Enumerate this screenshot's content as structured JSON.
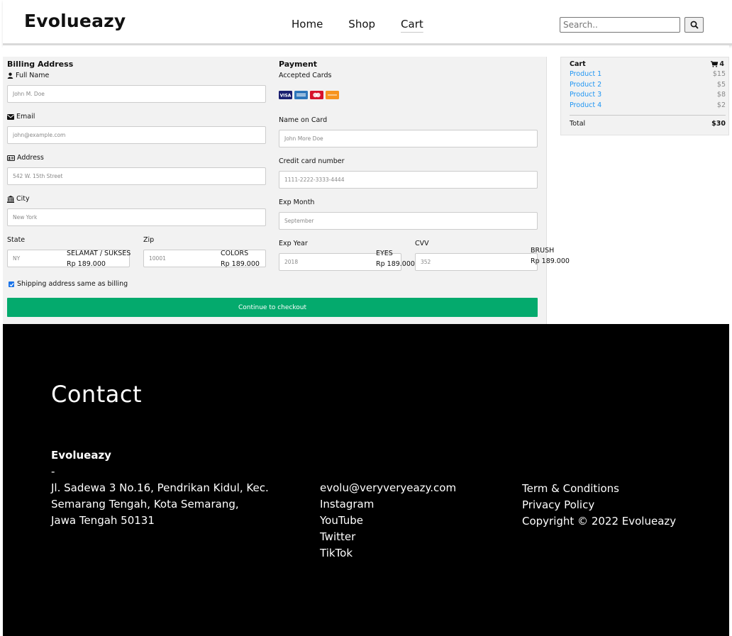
{
  "header": {
    "logo": "Evolueazy",
    "nav": [
      "Home",
      "Shop",
      "Cart"
    ],
    "search_placeholder": "Search.."
  },
  "billing": {
    "title": "Billing Address",
    "full_name_label": "Full Name",
    "full_name_placeholder": "John M. Doe",
    "email_label": "Email",
    "email_placeholder": "john@example.com",
    "address_label": "Address",
    "address_placeholder": "542 W. 15th Street",
    "city_label": "City",
    "city_placeholder": "New York",
    "state_label": "State",
    "state_placeholder": "NY",
    "zip_label": "Zip",
    "zip_placeholder": "10001"
  },
  "payment": {
    "title": "Payment",
    "accepted_cards_label": "Accepted Cards",
    "name_on_card_label": "Name on Card",
    "name_on_card_placeholder": "John More Doe",
    "cc_number_label": "Credit card number",
    "cc_number_placeholder": "1111-2222-3333-4444",
    "exp_month_label": "Exp Month",
    "exp_month_placeholder": "September",
    "exp_year_label": "Exp Year",
    "exp_year_placeholder": "2018",
    "cvv_label": "CVV",
    "cvv_placeholder": "352"
  },
  "shipping_same_label": "Shipping address same as billing",
  "checkout_button": "Continue to checkout",
  "overlay_products": [
    {
      "name": "SELAMAT / SUKSES",
      "price": "Rp 189.000"
    },
    {
      "name": "COLORS",
      "price": "Rp 189.000"
    },
    {
      "name": "EYES",
      "price": "Rp 189.000"
    },
    {
      "name": "BRUSH",
      "price": "Rp 189.000"
    }
  ],
  "cart": {
    "title": "Cart",
    "count": "4",
    "items": [
      {
        "name": "Product 1",
        "price": "$15"
      },
      {
        "name": "Product 2",
        "price": "$5"
      },
      {
        "name": "Product 3",
        "price": "$8"
      },
      {
        "name": "Product 4",
        "price": "$2"
      }
    ],
    "total_label": "Total",
    "total_value": "$30"
  },
  "footer": {
    "title": "Contact",
    "company": "Evolueazy",
    "dash": "-",
    "address_lines": [
      "Jl. Sadewa 3 No.16, Pendrikan Kidul, Kec.",
      "Semarang Tengah, Kota Semarang,",
      "Jawa Tengah 50131"
    ],
    "links": [
      "evolu@veryveryeazy.com",
      "Instagram",
      "YouTube",
      "Twitter",
      "TikTok"
    ],
    "legal": [
      "Term & Conditions",
      "Privacy Policy",
      "Copyright © 2022 Evolueazy"
    ]
  },
  "colors": {
    "checkout_green": "#04aa6d",
    "link_blue": "#2196f3",
    "footer_bg": "#000000"
  },
  "card_icons": [
    "visa-card-icon",
    "amex-card-icon",
    "mastercard-icon",
    "discover-card-icon"
  ]
}
